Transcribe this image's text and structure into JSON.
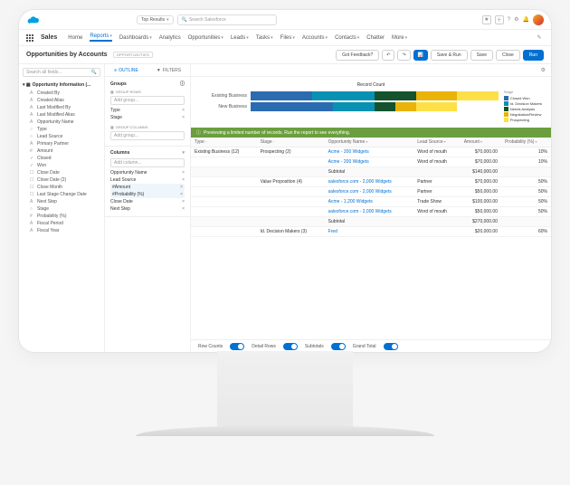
{
  "top": {
    "results_label": "Top Results",
    "search_placeholder": "Search Salesforce"
  },
  "nav": {
    "app": "Sales",
    "items": [
      "Home",
      "Reports",
      "Dashboards",
      "Analytics",
      "Opportunities",
      "Leads",
      "Tasks",
      "Files",
      "Accounts",
      "Contacts",
      "Chatter",
      "More"
    ]
  },
  "header": {
    "title": "Opportunities by Accounts",
    "badge": "OPPORTUNITIES",
    "feedback": "Got Feedback?",
    "save_run": "Save & Run",
    "save": "Save",
    "close": "Close",
    "run": "Run"
  },
  "left": {
    "search_placeholder": "Search all fields...",
    "root": "Opportunity Information (...",
    "items": [
      {
        "i": "A",
        "t": "Created By"
      },
      {
        "i": "A",
        "t": "Created Alias"
      },
      {
        "i": "A",
        "t": "Last Modified By"
      },
      {
        "i": "A",
        "t": "Last Modified Alias"
      },
      {
        "i": "A",
        "t": "Opportunity Name"
      },
      {
        "i": "○",
        "t": "Type"
      },
      {
        "i": "○",
        "t": "Lead Source"
      },
      {
        "i": "A",
        "t": "Primary Partner"
      },
      {
        "i": "#",
        "t": "Amount"
      },
      {
        "i": "✓",
        "t": "Closed"
      },
      {
        "i": "✓",
        "t": "Won"
      },
      {
        "i": "☐",
        "t": "Close Date"
      },
      {
        "i": "☐",
        "t": "Close Date (2)"
      },
      {
        "i": "☐",
        "t": "Close Month"
      },
      {
        "i": "☐",
        "t": "Last Stage Change Date"
      },
      {
        "i": "A",
        "t": "Next Step"
      },
      {
        "i": "○",
        "t": "Stage"
      },
      {
        "i": "#",
        "t": "Probability (%)"
      },
      {
        "i": "A",
        "t": "Fiscal Period"
      },
      {
        "i": "A",
        "t": "Fiscal Year"
      }
    ]
  },
  "mid": {
    "tabs": [
      "OUTLINE",
      "FILTERS"
    ],
    "groups_title": "Groups",
    "group_rows": "GROUP ROWS",
    "add_group": "Add group...",
    "type": "Type",
    "stage": "Stage",
    "group_cols": "GROUP COLUMNS",
    "columns_title": "Columns",
    "add_column": "Add column...",
    "cols": [
      "Opportunity Name",
      "Lead Source",
      "Amount",
      "Probability (%)",
      "Close Date",
      "Next Step"
    ]
  },
  "chart_data": {
    "type": "bar",
    "orientation": "horizontal-stacked",
    "title": "Record Count",
    "legend_title": "Stage",
    "categories": [
      "Existing Business",
      "New Business"
    ],
    "series": [
      {
        "name": "Closed Won",
        "color": "#2b6cb0",
        "values": [
          3,
          4
        ]
      },
      {
        "name": "Id. Decision Makers",
        "color": "#0891b2",
        "values": [
          3,
          2
        ]
      },
      {
        "name": "Needs Analysis",
        "color": "#14532d",
        "values": [
          2,
          1
        ]
      },
      {
        "name": "Negotiation/Review",
        "color": "#eab308",
        "values": [
          2,
          1
        ]
      },
      {
        "name": "Prospecting",
        "color": "#fde047",
        "values": [
          2,
          2
        ]
      }
    ],
    "xlim": [
      0,
      12
    ]
  },
  "preview_msg": "Previewing a limited number of records. Run the report to see everything.",
  "table": {
    "headers": [
      "Type",
      "Stage",
      "Opportunity Name",
      "Lead Source",
      "Amount",
      "Probability (%)"
    ],
    "rows": [
      {
        "type": "Existing Business (12)",
        "stage": "Prospecting (2)",
        "opp": "Acme - 200 Widgets",
        "lead": "Word of mouth",
        "amount": "$70,000.00",
        "prob": "10%"
      },
      {
        "type": "",
        "stage": "",
        "opp": "Acme - 200 Widgets",
        "lead": "Word of mouth",
        "amount": "$70,000.00",
        "prob": "10%"
      },
      {
        "subtotal": true,
        "label": "Subtotal",
        "amount": "$140,000.00"
      },
      {
        "type": "",
        "stage": "Value Proposition (4)",
        "opp": "salesforce.com - 2,000 Widgets",
        "lead": "Partner",
        "amount": "$70,000.00",
        "prob": "50%"
      },
      {
        "type": "",
        "stage": "",
        "opp": "salesforce.com - 2,000 Widgets",
        "lead": "Partner",
        "amount": "$50,000.00",
        "prob": "50%"
      },
      {
        "type": "",
        "stage": "",
        "opp": "Acme - 1,200 Widgets",
        "lead": "Trade Show",
        "amount": "$100,000.00",
        "prob": "50%"
      },
      {
        "type": "",
        "stage": "",
        "opp": "salesforce.com - 2,000 Widgets",
        "lead": "Word of mouth",
        "amount": "$50,000.00",
        "prob": "50%"
      },
      {
        "subtotal": true,
        "label": "Subtotal",
        "amount": "$270,000.00"
      },
      {
        "type": "",
        "stage": "Id. Decision Makers (3)",
        "opp": "Fred",
        "lead": "",
        "amount": "$20,000.00",
        "prob": "60%"
      }
    ]
  },
  "footer": {
    "row_counts": "Row Counts",
    "detail_rows": "Detail Rows",
    "subtotals": "Subtotals",
    "grand_total": "Grand Total"
  }
}
